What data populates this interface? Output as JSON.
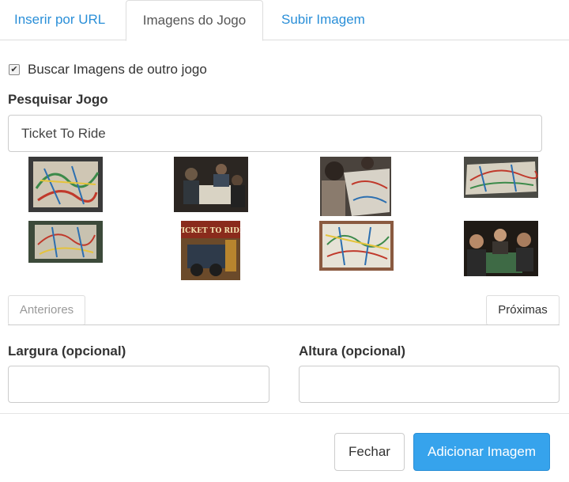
{
  "tabs": [
    {
      "label": "Inserir por URL",
      "active": false
    },
    {
      "label": "Imagens do Jogo",
      "active": true
    },
    {
      "label": "Subir Imagem",
      "active": false
    }
  ],
  "other_game": {
    "label": "Buscar Imagens de outro jogo",
    "checked": true
  },
  "search": {
    "label": "Pesquisar Jogo",
    "value": "Ticket To Ride"
  },
  "thumbnails": [
    {
      "icon": "game-board-photo-icon"
    },
    {
      "icon": "people-playing-photo-icon"
    },
    {
      "icon": "people-playing-photo-icon"
    },
    {
      "icon": "game-board-photo-icon"
    },
    {
      "icon": "game-board-photo-icon"
    },
    {
      "icon": "ticket-to-ride-box-cover-icon",
      "text": "TICKET TO RIDE"
    },
    {
      "icon": "game-board-photo-icon"
    },
    {
      "icon": "people-playing-photo-icon"
    }
  ],
  "pager": {
    "prev": "Anteriores",
    "next": "Próximas"
  },
  "width": {
    "label": "Largura (opcional)",
    "value": ""
  },
  "height": {
    "label": "Altura (opcional)",
    "value": ""
  },
  "footer": {
    "close": "Fechar",
    "add": "Adicionar Imagem"
  },
  "colors": {
    "accent": "#36a3ec",
    "link": "#2a8fd8"
  }
}
